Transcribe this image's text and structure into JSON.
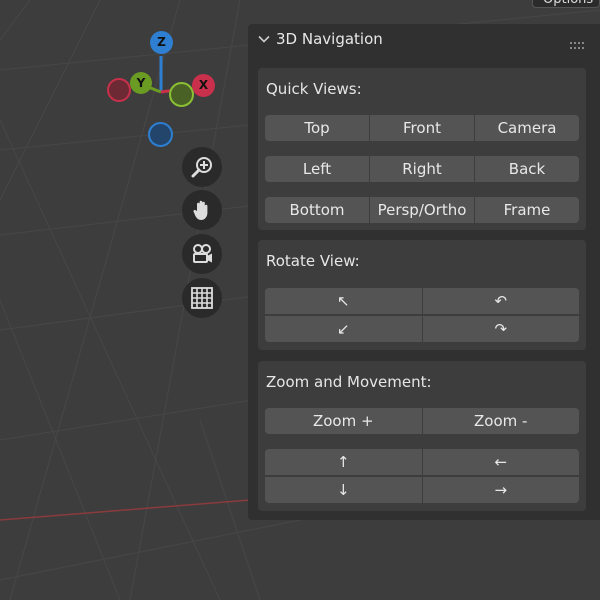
{
  "header": {
    "options_label": "Options"
  },
  "gizmo": {
    "z_label": "Z",
    "y_label": "Y",
    "x_label": "X",
    "colors": {
      "x": "#c8304b",
      "y": "#6a9b22",
      "z": "#2e7fd1"
    }
  },
  "viewport_tools": [
    {
      "name": "zoom-icon"
    },
    {
      "name": "hand-pan-icon"
    },
    {
      "name": "camera-icon"
    },
    {
      "name": "grid-icon"
    }
  ],
  "panel": {
    "title": "3D Navigation",
    "quick_views": {
      "title": "Quick Views:",
      "rows": [
        [
          "Top",
          "Front",
          "Camera"
        ],
        [
          "Left",
          "Right",
          "Back"
        ],
        [
          "Bottom",
          "Persp/Ortho",
          "Frame"
        ]
      ]
    },
    "rotate_view": {
      "title": "Rotate View:",
      "buttons": [
        "↖",
        "↶",
        "↙",
        "↷"
      ]
    },
    "zoom_movement": {
      "title": "Zoom and Movement:",
      "zoom_in": "Zoom +",
      "zoom_out": "Zoom -",
      "moves": [
        "↑",
        "←",
        "↓",
        "→"
      ]
    }
  }
}
